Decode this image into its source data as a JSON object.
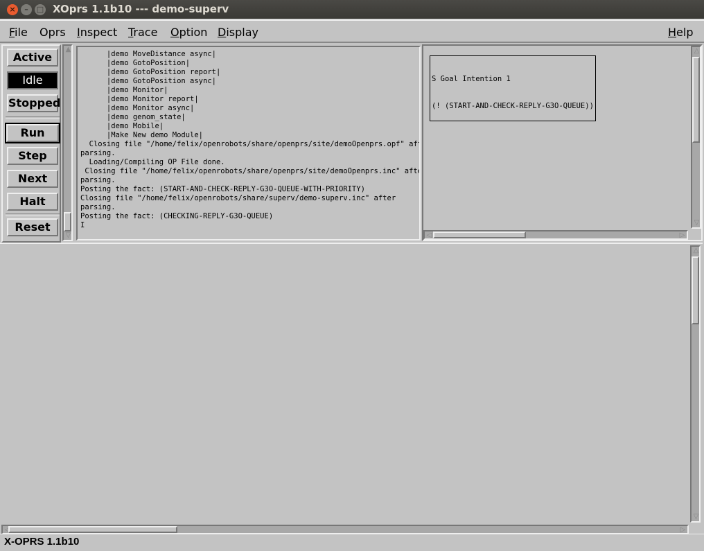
{
  "window": {
    "title": "XOprs 1.1b10 --- demo-superv",
    "close": "×",
    "minimize": "–",
    "maximize": "□"
  },
  "menu": [
    {
      "label": "File",
      "u": "F",
      "rest": "ile"
    },
    {
      "label": "Oprs",
      "u": "",
      "rest": "Oprs"
    },
    {
      "label": "Inspect",
      "u": "I",
      "rest": "nspect"
    },
    {
      "label": "Trace",
      "u": "T",
      "rest": "race"
    },
    {
      "label": "Option",
      "u": "O",
      "rest": "ption"
    },
    {
      "label": "Display",
      "u": "D",
      "rest": "isplay"
    },
    {
      "label": "Help",
      "u": "H",
      "rest": "elp"
    }
  ],
  "modes": {
    "active": "Active",
    "idle": "Idle",
    "stopped": "Stopped",
    "current": "Idle"
  },
  "controls": {
    "run": "Run",
    "step": "Step",
    "next": "Next",
    "halt": "Halt",
    "reset": "Reset"
  },
  "log": [
    "      |demo MoveDistance async|",
    "      |demo GotoPosition|",
    "      |demo GotoPosition report|",
    "      |demo GotoPosition async|",
    "      |demo Monitor|",
    "      |demo Monitor report|",
    "      |demo Monitor async|",
    "      |demo genom_state|",
    "      |demo Mobile|",
    "      |Make New demo Module|",
    "  Closing file \"/home/felix/openrobots/share/openprs/site/demoOpenprs.opf\" after",
    "parsing.",
    "  Loading/Compiling OP File done.",
    " Closing file \"/home/felix/openrobots/share/openprs/site/demoOpenprs.inc\" after",
    "parsing.",
    "Posting the fact: (START-AND-CHECK-REPLY-G3O-QUEUE-WITH-PRIORITY)",
    "Closing file \"/home/felix/openrobots/share/superv/demo-superv.inc\" after",
    "parsing.",
    "Posting the fact: (CHECKING-REPLY-G3O-QUEUE)",
    "I"
  ],
  "intentions": {
    "title": "S Goal Intention 1",
    "goal": "(! (START-AND-CHECK-REPLY-G3O-QUEUE))"
  },
  "status": "X-OPRS 1.1b10"
}
